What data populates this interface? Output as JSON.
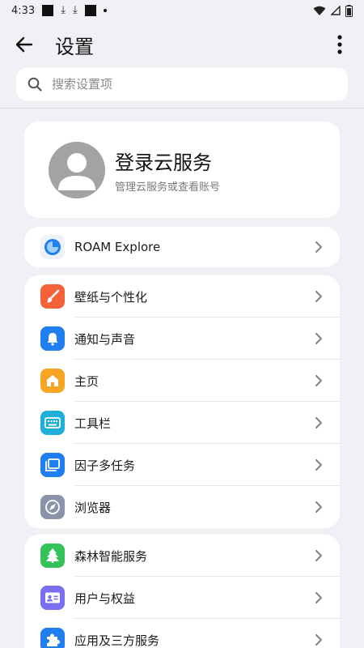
{
  "status_bar": {
    "time": "4:33"
  },
  "header": {
    "title": "设置"
  },
  "search": {
    "placeholder": "搜索设置项"
  },
  "account": {
    "title": "登录云服务",
    "subtitle": "管理云服务或查看账号"
  },
  "roam": {
    "label": "ROAM Explore"
  },
  "group1": [
    {
      "label": "壁纸与个性化",
      "icon": "paintbrush-icon",
      "color": "#f4623a"
    },
    {
      "label": "通知与声音",
      "icon": "bell-icon",
      "color": "#1f7ef0"
    },
    {
      "label": "主页",
      "icon": "home-icon",
      "color": "#f6a623"
    },
    {
      "label": "工具栏",
      "icon": "keyboard-icon",
      "color": "#1fb0d9"
    },
    {
      "label": "因子多任务",
      "icon": "multitask-icon",
      "color": "#1f7ef0"
    },
    {
      "label": "浏览器",
      "icon": "compass-icon",
      "color": "#8a93a8"
    }
  ],
  "group2": [
    {
      "label": "森林智能服务",
      "icon": "tree-icon",
      "color": "#34c25b"
    },
    {
      "label": "用户与权益",
      "icon": "id-card-icon",
      "color": "#7a6ff0"
    },
    {
      "label": "应用及三方服务",
      "icon": "puzzle-icon",
      "color": "#1f7ef0"
    }
  ]
}
